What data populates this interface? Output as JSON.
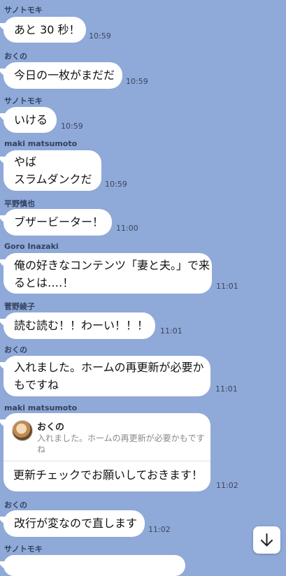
{
  "messages": [
    {
      "sender": "サノトモキ",
      "text": "あと 30 秒！",
      "time": "10:59"
    },
    {
      "sender": "おくの",
      "text": "今日の一枚がまだだ",
      "time": "10:59"
    },
    {
      "sender": "サノトモキ",
      "text": "いける",
      "time": "10:59"
    },
    {
      "sender": "maki matsumoto",
      "lines": [
        "やば",
        "スラムダンクだ"
      ],
      "time": "10:59"
    },
    {
      "sender": "平野慎也",
      "text": "ブザービーター！",
      "time": "11:00"
    },
    {
      "sender": "Goro Inazaki",
      "lines": [
        "俺の好きなコンテンツ「妻と夫。」で来",
        "るとは‥‥！"
      ],
      "time": "11:01"
    },
    {
      "sender": "菅野綾子",
      "text": "読む読む！！わーい！！！",
      "time": "11:01"
    },
    {
      "sender": "おくの",
      "lines": [
        "入れました。ホームの再更新が必要か",
        "もですね"
      ],
      "time": "11:01"
    },
    {
      "sender": "maki matsumoto",
      "quote": {
        "name": "おくの",
        "text": "入れました。ホームの再更新が必要かもです ね"
      },
      "text": "更新チェックでお願いしておきます！",
      "time": "11:02"
    },
    {
      "sender": "おくの",
      "text": "改行が変なので直します",
      "time": "11:02"
    },
    {
      "sender": "サノトモキ"
    }
  ],
  "scroll_button": {
    "icon": "arrow-down-icon"
  }
}
